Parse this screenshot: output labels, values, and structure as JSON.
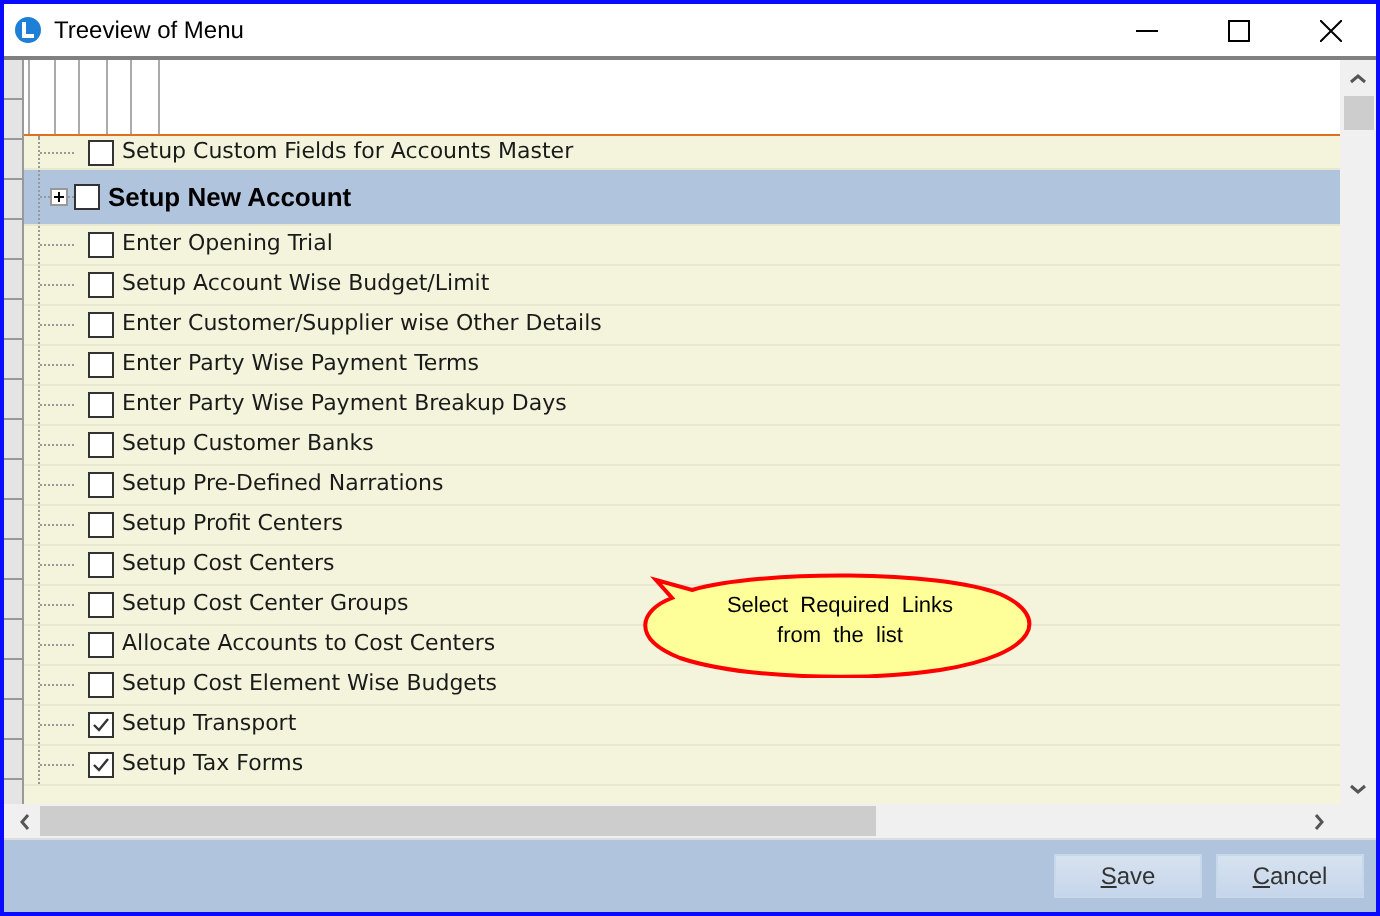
{
  "window": {
    "title": "Treeview of Menu"
  },
  "tree": {
    "rows": [
      {
        "label": "Setup Custom Fields for Accounts Master",
        "kind": "item",
        "checked": false,
        "selected": false
      },
      {
        "label": "Setup New Account",
        "kind": "group",
        "expanded": false,
        "checked": false,
        "selected": true
      },
      {
        "label": "Enter Opening Trial",
        "kind": "item",
        "checked": false,
        "selected": false
      },
      {
        "label": "Setup Account Wise Budget/Limit",
        "kind": "item",
        "checked": false,
        "selected": false
      },
      {
        "label": "Enter Customer/Supplier wise Other Details",
        "kind": "item",
        "checked": false,
        "selected": false
      },
      {
        "label": "Enter Party Wise Payment Terms",
        "kind": "item",
        "checked": false,
        "selected": false
      },
      {
        "label": "Enter Party Wise Payment Breakup Days",
        "kind": "item",
        "checked": false,
        "selected": false
      },
      {
        "label": "Setup Customer Banks",
        "kind": "item",
        "checked": false,
        "selected": false
      },
      {
        "label": "Setup Pre-Defined Narrations",
        "kind": "item",
        "checked": false,
        "selected": false
      },
      {
        "label": "Setup Profit Centers",
        "kind": "item",
        "checked": false,
        "selected": false
      },
      {
        "label": "Setup Cost Centers",
        "kind": "item",
        "checked": false,
        "selected": false
      },
      {
        "label": "Setup Cost Center Groups",
        "kind": "item",
        "checked": false,
        "selected": false
      },
      {
        "label": "Allocate Accounts to Cost Centers",
        "kind": "item",
        "checked": false,
        "selected": false
      },
      {
        "label": "Setup Cost Element Wise Budgets",
        "kind": "item",
        "checked": false,
        "selected": false
      },
      {
        "label": "Setup Transport",
        "kind": "item",
        "checked": true,
        "selected": false
      },
      {
        "label": "Setup Tax Forms",
        "kind": "item",
        "checked": true,
        "selected": false
      }
    ]
  },
  "callout": {
    "lines": [
      "Select  Required  Links",
      "from  the  list"
    ]
  },
  "buttons": [
    "Save",
    "Cancel"
  ]
}
